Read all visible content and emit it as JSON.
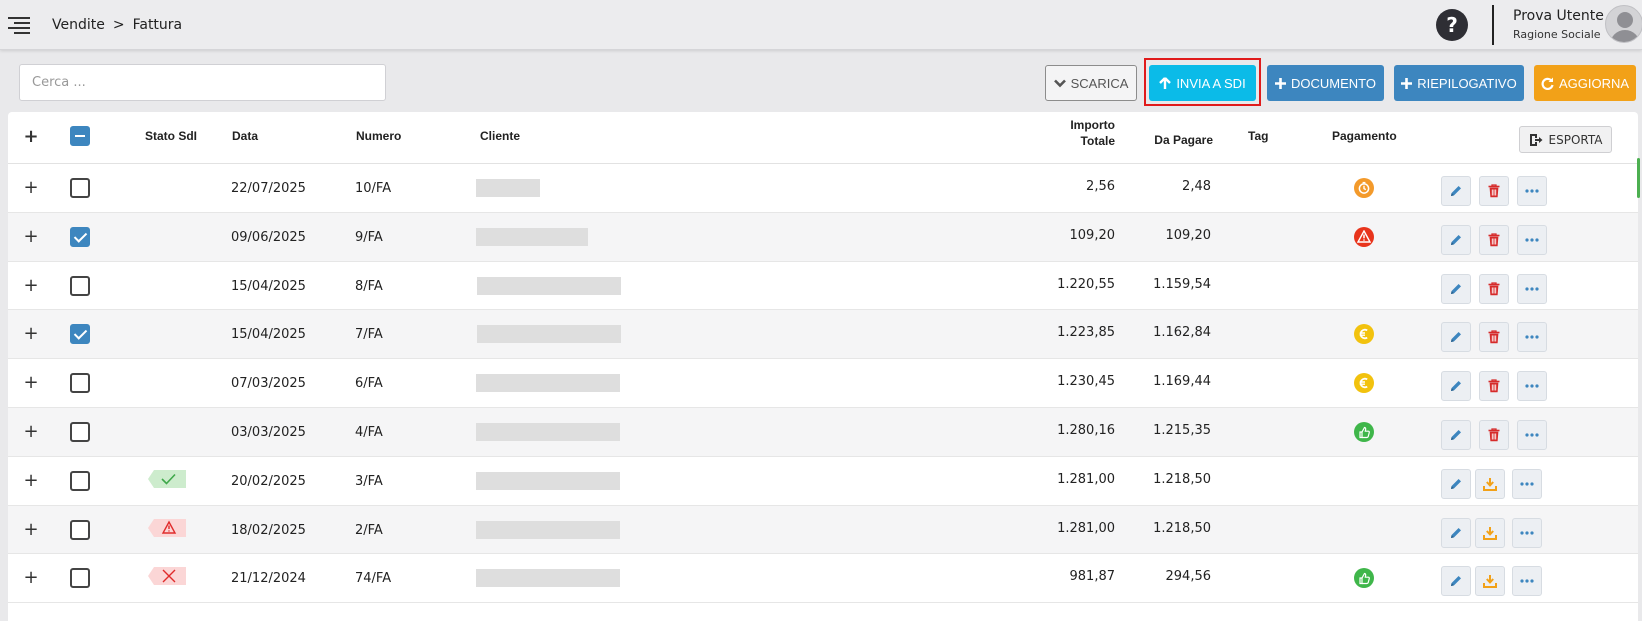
{
  "breadcrumb": {
    "section": "Vendite",
    "separator": ">",
    "page": "Fattura"
  },
  "user": {
    "name": "Prova Utente",
    "company": "Ragione Sociale"
  },
  "help_label": "?",
  "search": {
    "placeholder": "Cerca ..."
  },
  "toolbar": {
    "scarica": "SCARICA",
    "invia_sdi": "INVIA A SDI",
    "documento": "DOCUMENTO",
    "riepilogativo": "RIEPILOGATIVO",
    "aggiorna": "AGGIORNA"
  },
  "colors": {
    "sdi": "#0bbbe8",
    "primary": "#3d86bf",
    "warning": "#f2a118",
    "highlight": "#e01b1b"
  },
  "table": {
    "headers": {
      "stato_sdi": "Stato SdI",
      "data": "Data",
      "numero": "Numero",
      "cliente": "Cliente",
      "importo_1": "Importo",
      "importo_2": "Totale",
      "da_pagare": "Da Pagare",
      "tag": "Tag",
      "pagamento": "Pagamento",
      "esporta": "ESPORTA"
    },
    "rows": [
      {
        "data": "22/07/2025",
        "numero": "10/FA",
        "importo": "2,56",
        "da_pagare": "2,48",
        "checked": false,
        "sdi": "",
        "pay": "clock",
        "second_action": "delete"
      },
      {
        "data": "09/06/2025",
        "numero": "9/FA",
        "importo": "109,20",
        "da_pagare": "109,20",
        "checked": true,
        "sdi": "",
        "pay": "alert",
        "second_action": "delete"
      },
      {
        "data": "15/04/2025",
        "numero": "8/FA",
        "importo": "1.220,55",
        "da_pagare": "1.159,54",
        "checked": false,
        "sdi": "",
        "pay": "",
        "second_action": "delete"
      },
      {
        "data": "15/04/2025",
        "numero": "7/FA",
        "importo": "1.223,85",
        "da_pagare": "1.162,84",
        "checked": true,
        "sdi": "",
        "pay": "euro",
        "second_action": "delete"
      },
      {
        "data": "07/03/2025",
        "numero": "6/FA",
        "importo": "1.230,45",
        "da_pagare": "1.169,44",
        "checked": false,
        "sdi": "",
        "pay": "euro",
        "second_action": "delete"
      },
      {
        "data": "03/03/2025",
        "numero": "4/FA",
        "importo": "1.280,16",
        "da_pagare": "1.215,35",
        "checked": false,
        "sdi": "",
        "pay": "thumb",
        "second_action": "delete"
      },
      {
        "data": "20/02/2025",
        "numero": "3/FA",
        "importo": "1.281,00",
        "da_pagare": "1.218,50",
        "checked": false,
        "sdi": "ok",
        "pay": "",
        "second_action": "download"
      },
      {
        "data": "18/02/2025",
        "numero": "2/FA",
        "importo": "1.281,00",
        "da_pagare": "1.218,50",
        "checked": false,
        "sdi": "warn",
        "pay": "",
        "second_action": "download"
      },
      {
        "data": "21/12/2024",
        "numero": "74/FA",
        "importo": "981,87",
        "da_pagare": "294,56",
        "checked": false,
        "sdi": "error",
        "pay": "thumb",
        "second_action": "download"
      }
    ]
  }
}
